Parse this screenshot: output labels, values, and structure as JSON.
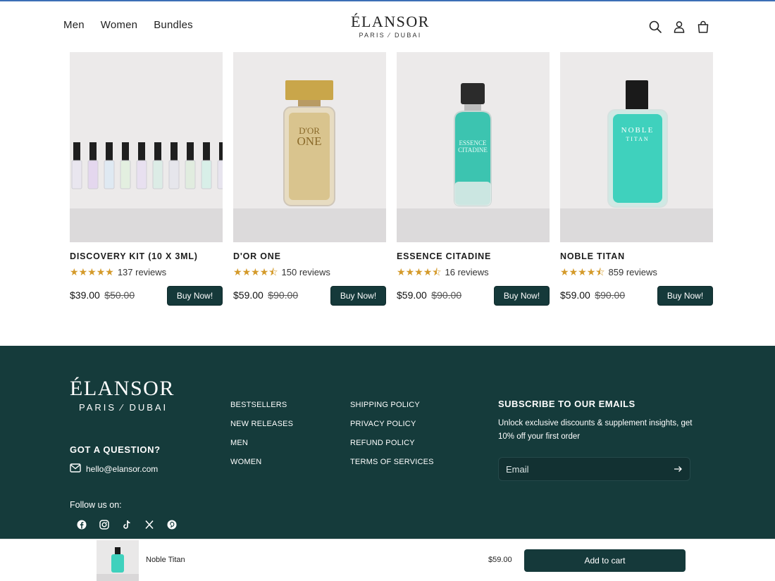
{
  "colors": {
    "brand_dark": "#153b3b",
    "star": "#d49a2a",
    "bg": "#ffffff"
  },
  "header": {
    "nav": [
      "Men",
      "Women",
      "Bundles"
    ],
    "logo_main": "ÉLANSOR",
    "logo_sub": "PARIS ⁄ DUBAI",
    "icons": [
      "search-icon",
      "account-icon",
      "cart-icon"
    ]
  },
  "products": [
    {
      "title": "DISCOVERY KIT (10 X 3ML)",
      "rating": 5,
      "reviews": "137 reviews",
      "price": "$39.00",
      "old_price": "$50.00",
      "button": "Buy Now!"
    },
    {
      "title": "D'OR ONE",
      "rating": 4.5,
      "reviews": "150 reviews",
      "price": "$59.00",
      "old_price": "$90.00",
      "button": "Buy Now!"
    },
    {
      "title": "ESSENCE CITADINE",
      "rating": 4.5,
      "reviews": "16 reviews",
      "price": "$59.00",
      "old_price": "$90.00",
      "button": "Buy Now!"
    },
    {
      "title": "NOBLE TITAN",
      "rating": 4.5,
      "reviews": "859 reviews",
      "price": "$59.00",
      "old_price": "$90.00",
      "button": "Buy Now!"
    }
  ],
  "footer": {
    "logo_main": "ÉLANSOR",
    "logo_sub": "PARIS ⁄ DUBAI",
    "question_title": "GOT A QUESTION?",
    "email": "hello@elansor.com",
    "follow": "Follow us on:",
    "socials": [
      "facebook-icon",
      "instagram-icon",
      "tiktok-icon",
      "x-icon",
      "pinterest-icon"
    ],
    "col1": [
      "BESTSELLERS",
      "NEW RELEASES",
      "MEN",
      "WOMEN"
    ],
    "col2": [
      "SHIPPING POLICY",
      "PRIVACY POLICY",
      "REFUND POLICY",
      "TERMS OF SERVICES"
    ],
    "subscribe_title": "SUBSCRIBE TO OUR EMAILS",
    "subscribe_text": "Unlock exclusive discounts & supplement insights, get 10% off your first order",
    "email_placeholder": "Email"
  },
  "sticky": {
    "name": "Noble Titan",
    "price": "$59.00",
    "button": "Add to cart"
  }
}
